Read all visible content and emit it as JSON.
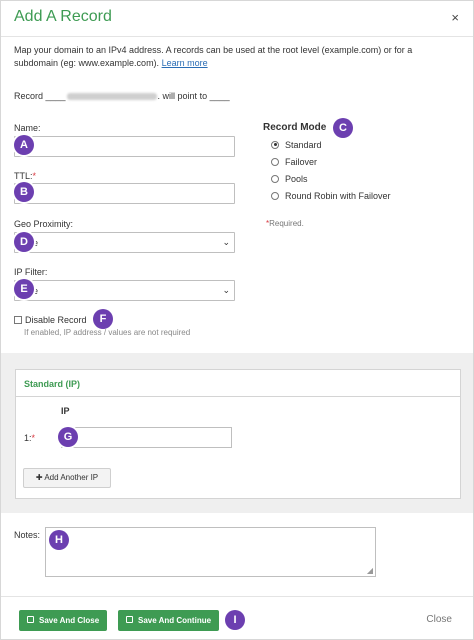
{
  "dialog": {
    "title": "Add A Record",
    "close_glyph": "×",
    "description": "Map your domain to an IPv4 address. A records can be used at the root level (example.com) or for a subdomain (eg: www.example.com).",
    "learn_more": "Learn more",
    "record_prefix": "Record ____",
    "record_suffix": ". will point to ____"
  },
  "form": {
    "name_label": "Name:",
    "ttl_label": "TTL:",
    "required_mark": "*",
    "geo_label": "Geo Proximity:",
    "geo_value": "e",
    "ipfilter_label": "IP Filter:",
    "ipfilter_value": "e",
    "disable_label": "Disable Record",
    "disable_hint": "If enabled, IP address / values are not required",
    "chevron": "⌄"
  },
  "record_mode": {
    "title": "Record Mode",
    "options": [
      {
        "label": "Standard",
        "selected": true
      },
      {
        "label": "Failover",
        "selected": false
      },
      {
        "label": "Pools",
        "selected": false
      },
      {
        "label": "Round Robin with Failover",
        "selected": false
      }
    ],
    "required_note": "Required."
  },
  "ip_panel": {
    "title": "Standard (IP)",
    "column": "IP",
    "row_label": "1:",
    "add_button": "Add Another IP"
  },
  "notes": {
    "label": "Notes:"
  },
  "footer": {
    "save_close": "Save And Close",
    "save_continue": "Save And Continue",
    "close": "Close"
  },
  "markers": [
    "A",
    "B",
    "C",
    "D",
    "E",
    "F",
    "G",
    "H",
    "I"
  ],
  "colors": {
    "accent": "#3e9b53",
    "marker": "#6c3fb0",
    "link": "#2a6db5",
    "required": "#d9363e"
  }
}
